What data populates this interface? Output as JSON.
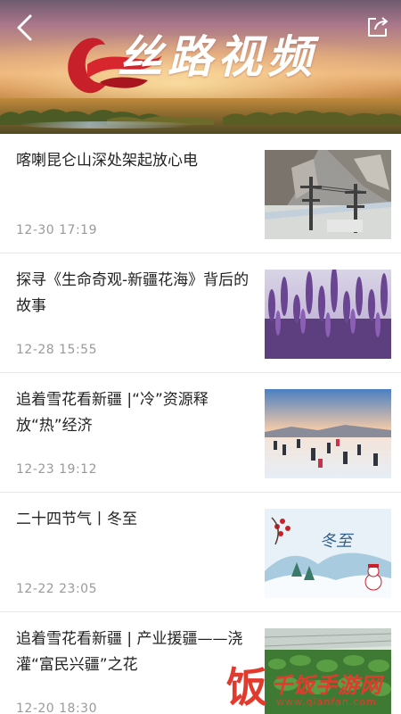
{
  "header": {
    "logo_text": "丝路视频",
    "back_icon": "back-icon",
    "share_icon": "share-icon"
  },
  "news": [
    {
      "title": "喀喇昆仑山深处架起放心电",
      "time": "12-30  17:19",
      "thumb": "mountain-power-tower-photo"
    },
    {
      "title": "探寻《生命奇观-新疆花海》背后的故事",
      "time": "12-28  15:55",
      "thumb": "lavander-field-photo"
    },
    {
      "title": "追着雪花看新疆 |“冷”资源释放“热”经济",
      "time": "12-23  19:12",
      "thumb": "snow-field-people-photo"
    },
    {
      "title": "二十四节气丨冬至",
      "time": "12-22  23:05",
      "thumb": "winter-solstice-illustration"
    },
    {
      "title": "追着雪花看新疆 | 产业援疆——浇灌“富民兴疆”之花",
      "time": "12-20  18:30",
      "thumb": "greenhouse-photo"
    }
  ],
  "watermark": {
    "icon_char": "饭",
    "text": "千饭手游网",
    "url": "www.qianfan.com"
  },
  "colors": {
    "title_text": "#222222",
    "time_text": "#9a9a9a",
    "divider": "#e6e6e6",
    "watermark": "#e23b2e"
  }
}
